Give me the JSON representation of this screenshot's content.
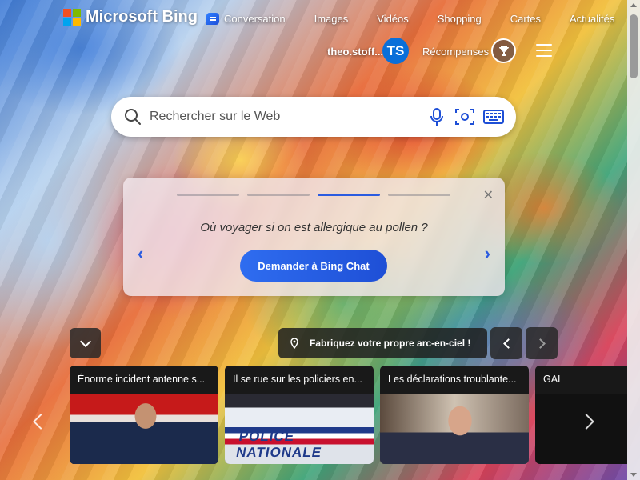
{
  "header": {
    "brand": "Microsoft Bing",
    "nav": [
      {
        "label": "Conversation",
        "icon": "chat-icon"
      },
      {
        "label": "Images"
      },
      {
        "label": "Vidéos"
      },
      {
        "label": "Shopping"
      },
      {
        "label": "Cartes"
      },
      {
        "label": "Actualités"
      }
    ],
    "username": "theo.stoff...",
    "avatar_initials": "TS",
    "rewards_label": "Récompenses",
    "rewards_icon": "trophy-icon",
    "menu_icon": "hamburger-icon"
  },
  "search": {
    "placeholder": "Rechercher sur le Web",
    "icons": [
      "search-icon",
      "microphone-icon",
      "visual-search-icon",
      "keyboard-icon"
    ]
  },
  "carousel": {
    "progress_segments": 4,
    "active_segment": 3,
    "question": "Où voyager si on est allergique au pollen ?",
    "button_label": "Demander à Bing Chat"
  },
  "feed": {
    "location_label": "Fabriquez votre propre arc-en-ciel !",
    "tiles": [
      {
        "title": "Énorme incident antenne s..."
      },
      {
        "title": "Il se rue sur les policiers en..."
      },
      {
        "title": "Les déclarations troublante..."
      },
      {
        "title": "GAI"
      }
    ]
  },
  "colors": {
    "accent": "#2a5be0",
    "avatar": "#0a6fd9"
  }
}
